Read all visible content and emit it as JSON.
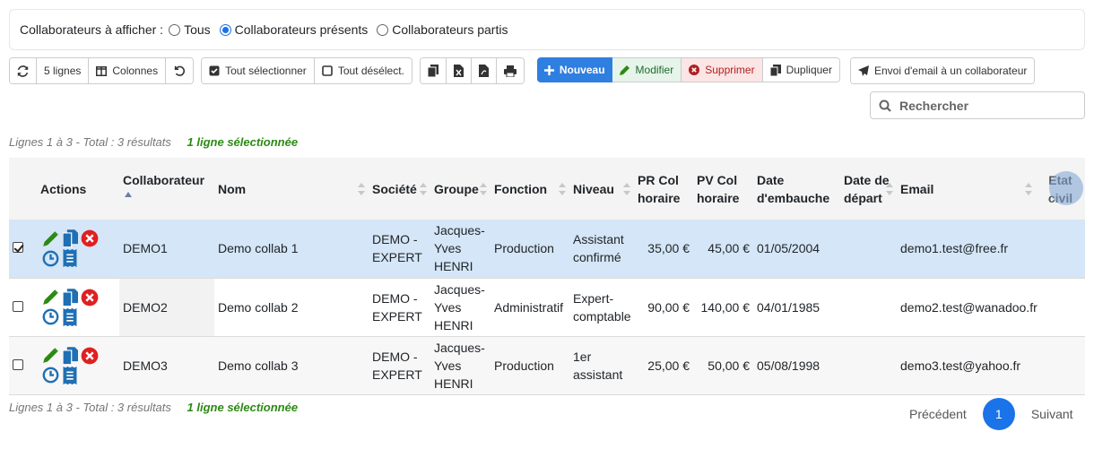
{
  "filter": {
    "label": "Collaborateurs à afficher :",
    "options": [
      {
        "label": "Tous",
        "selected": false
      },
      {
        "label": "Collaborateurs présents",
        "selected": true
      },
      {
        "label": "Collaborateurs partis",
        "selected": false
      }
    ]
  },
  "toolbar": {
    "refresh_icon": "refresh-icon",
    "lines_label": "5 lignes",
    "columns_label": "Colonnes",
    "reset_icon": "undo-icon",
    "select_all_label": "Tout sélectionner",
    "deselect_all_label": "Tout désélect.",
    "copy_icon": "copy-icon",
    "excel_icon": "excel-icon",
    "pdf_icon": "pdf-icon",
    "print_icon": "print-icon",
    "new_label": "Nouveau",
    "edit_label": "Modifier",
    "delete_label": "Supprimer",
    "duplicate_label": "Dupliquer",
    "email_label": "Envoi d'email à un collaborateur"
  },
  "search": {
    "placeholder": "Rechercher"
  },
  "info": {
    "summary": "Lignes 1 à 3 - Total : 3 résultats",
    "selected": "1 ligne sélectionnée"
  },
  "table": {
    "headers": {
      "actions": "Actions",
      "collaborateur": "Collaborateur",
      "nom": "Nom",
      "societe": "Société",
      "groupe": "Groupe",
      "fonction": "Fonction",
      "niveau": "Niveau",
      "pr_col": "PR Col horaire",
      "pv_col": "PV Col horaire",
      "date_embauche": "Date d'embauche",
      "date_depart": "Date de départ",
      "email": "Email",
      "etat_civil": "Etat civil"
    },
    "rows": [
      {
        "selected": true,
        "collaborateur": "DEMO1",
        "nom": "Demo collab 1",
        "societe": "DEMO - EXPERT",
        "groupe": "Jacques-Yves HENRI",
        "fonction": "Production",
        "niveau": "Assistant confirmé",
        "pr_col": "35,00 €",
        "pv_col": "45,00 €",
        "date_embauche": "01/05/2004",
        "date_depart": "",
        "email": "demo1.test@free.fr",
        "etat_civil": ""
      },
      {
        "selected": false,
        "collaborateur": "DEMO2",
        "nom": "Demo collab 2",
        "societe": "DEMO - EXPERT",
        "groupe": "Jacques-Yves HENRI",
        "fonction": "Administratif",
        "niveau": "Expert-comptable",
        "pr_col": "90,00 €",
        "pv_col": "140,00 €",
        "date_embauche": "04/01/1985",
        "date_depart": "",
        "email": "demo2.test@wanadoo.fr",
        "etat_civil": ""
      },
      {
        "selected": false,
        "collaborateur": "DEMO3",
        "nom": "Demo collab 3",
        "societe": "DEMO - EXPERT",
        "groupe": "Jacques-Yves HENRI",
        "fonction": "Production",
        "niveau": "1er assistant",
        "pr_col": "25,00 €",
        "pv_col": "50,00 €",
        "date_embauche": "05/08/1998",
        "date_depart": "",
        "email": "demo3.test@yahoo.fr",
        "etat_civil": ""
      }
    ]
  },
  "pager": {
    "previous": "Précédent",
    "current": "1",
    "next": "Suivant"
  },
  "colors": {
    "primary": "#1a73e8",
    "edit": "#2c8a13",
    "delete": "#e02020",
    "icon_blue": "#1f6fb4",
    "selected_row": "#d4e6f7"
  }
}
